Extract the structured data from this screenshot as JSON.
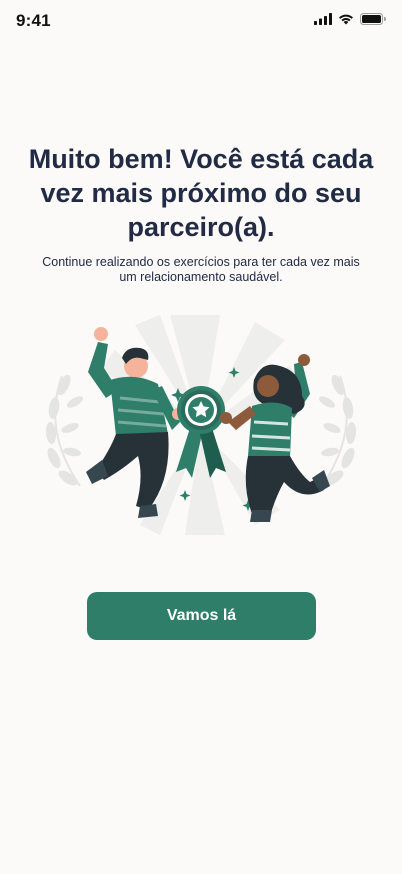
{
  "status_bar": {
    "time": "9:41",
    "icons": [
      "cellular-signal-icon",
      "wifi-icon",
      "battery-icon"
    ]
  },
  "content": {
    "headline": "Muito bem! Você está cada vez mais próximo do seu parceiro(a).",
    "subtext": "Continue realizando os exercícios para ter cada vez mais um relacionamento saudável."
  },
  "illustration": {
    "name": "celebration-illustration",
    "elements": [
      "man-jumping",
      "woman-jumping",
      "award-rosette-icon",
      "laurel-wreath"
    ]
  },
  "actions": {
    "primary_label": "Vamos lá"
  },
  "colors": {
    "background": "#fbfaf8",
    "primary": "#2e7e69",
    "text": "#222b45"
  }
}
